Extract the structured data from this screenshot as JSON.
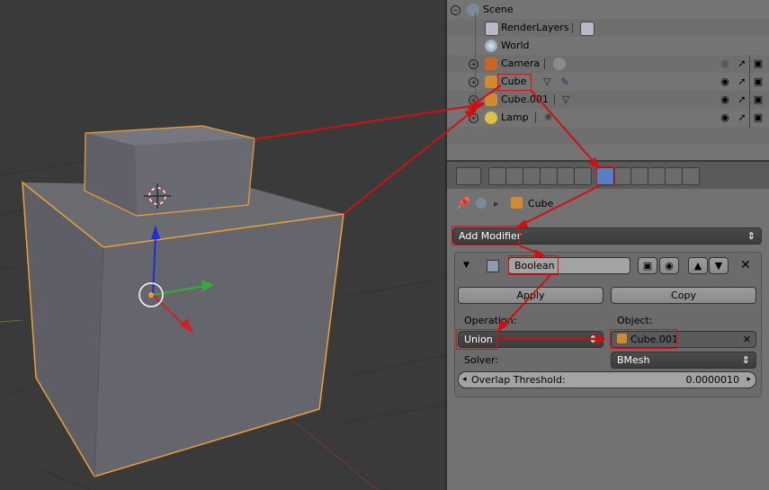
{
  "outliner": {
    "items": [
      {
        "label": "Scene"
      },
      {
        "label": "RenderLayers"
      },
      {
        "label": "World"
      },
      {
        "label": "Camera"
      },
      {
        "label": "Cube"
      },
      {
        "label": "Cube.001"
      },
      {
        "label": "Lamp"
      }
    ]
  },
  "breadcrumb": {
    "object": "Cube"
  },
  "modifier_panel": {
    "add_modifier": "Add Modifier",
    "modifier_name": "Boolean",
    "apply": "Apply",
    "copy": "Copy",
    "operation_label": "Operation:",
    "operation_value": "Union",
    "object_label": "Object:",
    "object_value": "Cube.001",
    "solver_label": "Solver:",
    "solver_value": "BMesh",
    "threshold_label": "Overlap Threshold:",
    "threshold_value": "0.0000010"
  },
  "colors": {
    "selection_outline": "#f0a030",
    "annotation": "#e01010",
    "active_tab": "#5680c2"
  }
}
